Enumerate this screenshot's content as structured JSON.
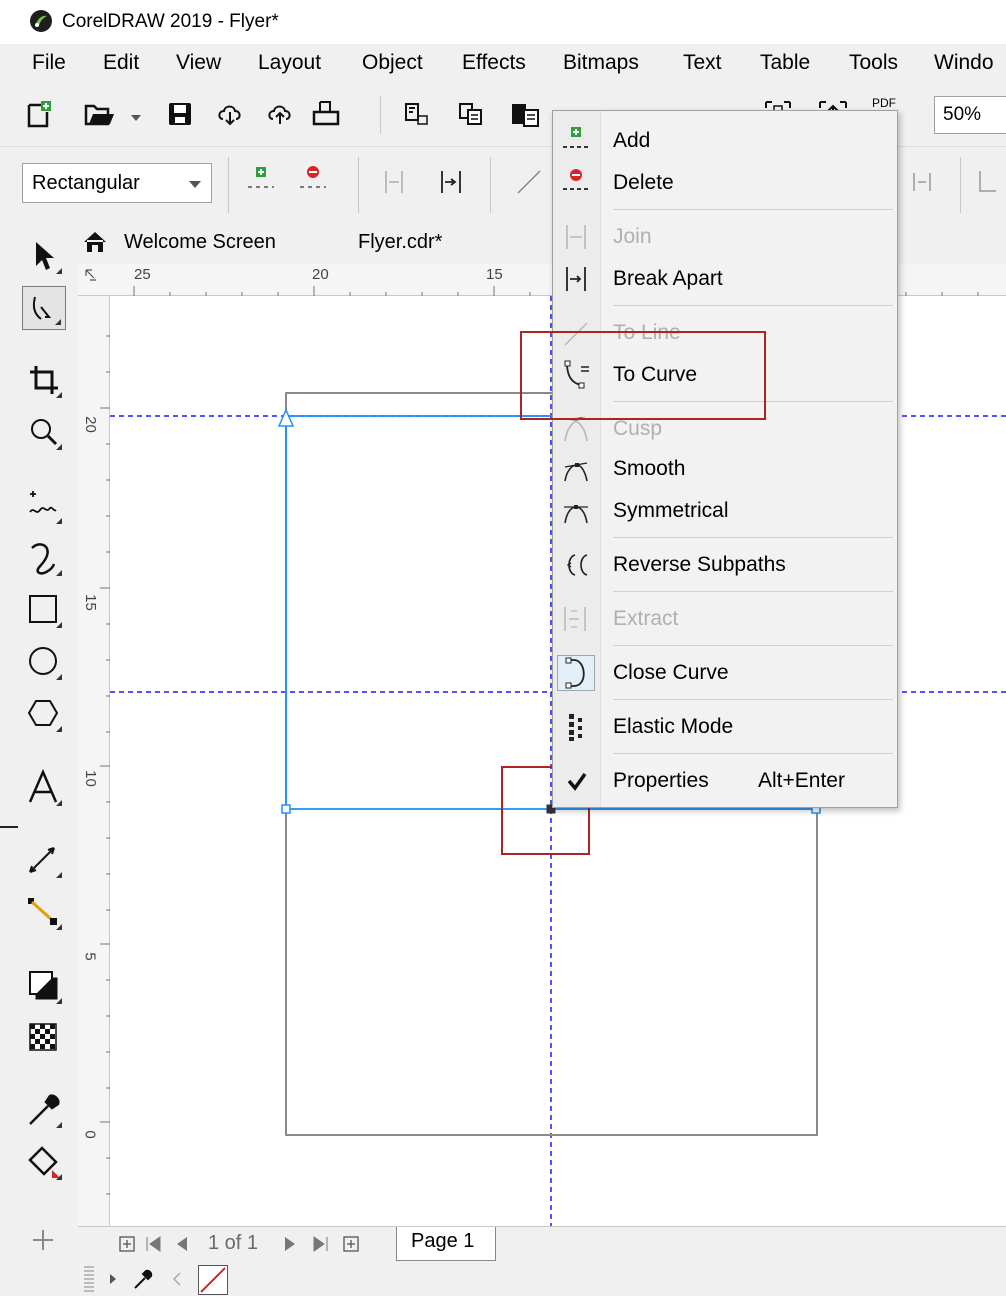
{
  "window": {
    "title": "CorelDRAW 2019 - Flyer*"
  },
  "menubar": {
    "items": [
      "File",
      "Edit",
      "View",
      "Layout",
      "Object",
      "Effects",
      "Bitmaps",
      "Text",
      "Table",
      "Tools",
      "Windo"
    ]
  },
  "toolbar": {
    "zoom_value": "50%",
    "pdf_label": "PDF"
  },
  "property_bar": {
    "shape_select_value": "Rectangular"
  },
  "tabs": {
    "welcome": "Welcome Screen",
    "document": "Flyer.cdr*"
  },
  "rulers": {
    "horizontal_labels": [
      "25",
      "20",
      "15"
    ],
    "vertical_labels": [
      "20",
      "15",
      "10",
      "5",
      "0"
    ]
  },
  "page_nav": {
    "info": "1 of 1",
    "page_tab": "Page 1"
  },
  "context_menu": {
    "items": [
      {
        "label": "Add",
        "enabled": true,
        "icon": "add-node-icon"
      },
      {
        "label": "Delete",
        "enabled": true,
        "icon": "delete-node-icon"
      },
      {
        "label": "Join",
        "enabled": false,
        "icon": "join-nodes-icon"
      },
      {
        "label": "Break Apart",
        "enabled": true,
        "icon": "break-apart-icon"
      },
      {
        "label": "To Line",
        "enabled": false,
        "icon": "to-line-icon"
      },
      {
        "label": "To Curve",
        "enabled": true,
        "icon": "to-curve-icon"
      },
      {
        "label": "Cusp",
        "enabled": false,
        "icon": "cusp-icon"
      },
      {
        "label": "Smooth",
        "enabled": true,
        "icon": "smooth-icon"
      },
      {
        "label": "Symmetrical",
        "enabled": true,
        "icon": "symmetrical-icon"
      },
      {
        "label": "Reverse Subpaths",
        "enabled": true,
        "icon": "reverse-subpaths-icon"
      },
      {
        "label": "Extract",
        "enabled": false,
        "icon": "extract-icon"
      },
      {
        "label": "Close Curve",
        "enabled": true,
        "icon": "close-curve-icon"
      },
      {
        "label": "Elastic Mode",
        "enabled": true,
        "icon": "elastic-mode-icon"
      },
      {
        "label": "Properties",
        "enabled": true,
        "icon": "check-icon",
        "shortcut": "Alt+Enter"
      }
    ]
  },
  "colors": {
    "chrome": "#f0f0f0",
    "selection_blue": "#1e90ff",
    "guide_blue": "#1a1aff",
    "highlight_red": "#b22222",
    "disabled_text": "#b0b0b0"
  }
}
